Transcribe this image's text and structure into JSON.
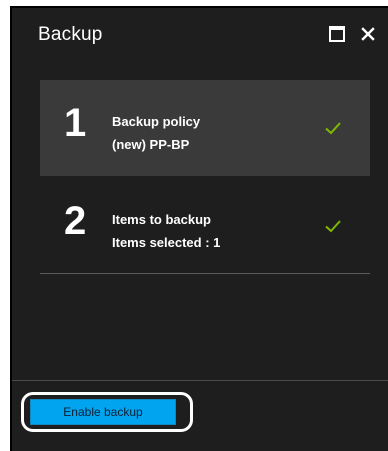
{
  "blade": {
    "title": "Backup"
  },
  "window_controls": {
    "maximize_icon": "maximize-icon",
    "close_icon": "close-icon",
    "close_glyph": "✕"
  },
  "steps": [
    {
      "number": "1",
      "line1": "Backup policy",
      "line2": "(new) PP-BP",
      "status_icon": "checkmark-icon",
      "selected": true
    },
    {
      "number": "2",
      "line1": "Items to backup",
      "line2": "Items selected : 1",
      "status_icon": "checkmark-icon",
      "selected": false
    }
  ],
  "footer": {
    "enable_label": "Enable backup"
  },
  "colors": {
    "blade_background": "#1e1e1e",
    "selected_step_background": "#3a3a3a",
    "check_green": "#7fba00",
    "primary_button": "#00a4ef"
  }
}
